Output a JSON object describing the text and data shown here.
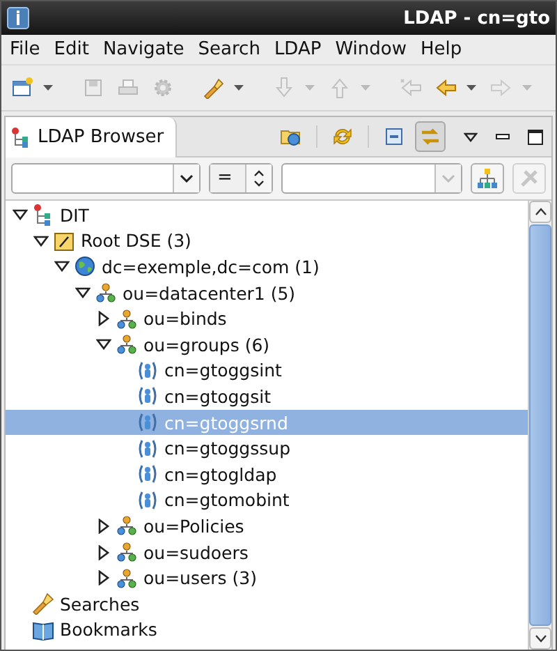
{
  "window": {
    "title": "LDAP - cn=gto"
  },
  "menu": [
    "File",
    "Edit",
    "Navigate",
    "Search",
    "LDAP",
    "Window",
    "Help"
  ],
  "toolbar": [
    {
      "kind": "new-window",
      "disabled": false,
      "dropdown": true
    },
    {
      "kind": "save",
      "disabled": true,
      "dropdown": false
    },
    {
      "kind": "print",
      "disabled": true,
      "dropdown": false
    },
    {
      "kind": "gear",
      "disabled": true,
      "dropdown": false
    },
    {
      "kind": "search",
      "disabled": false,
      "dropdown": true
    },
    {
      "kind": "import",
      "disabled": true,
      "dropdown": true
    },
    {
      "kind": "export",
      "disabled": true,
      "dropdown": true
    },
    {
      "kind": "last-edit",
      "disabled": true,
      "dropdown": false
    },
    {
      "kind": "back",
      "disabled": false,
      "dropdown": true
    },
    {
      "kind": "forward",
      "disabled": true,
      "dropdown": true
    }
  ],
  "view": {
    "tab": {
      "label": "LDAP Browser",
      "selected": true
    },
    "actions": [
      {
        "kind": "open-connection",
        "on": false
      },
      {
        "kind": "refresh",
        "on": false
      },
      {
        "kind": "collapse",
        "on": false
      },
      {
        "kind": "link",
        "on": true
      }
    ],
    "filter": {
      "attribute_disabled": false,
      "operator": "=",
      "value_disabled": true,
      "apply_disabled": false,
      "clear_disabled": true
    },
    "tree": [
      {
        "label": "DIT",
        "kind": "dit",
        "expanded": true,
        "selected": false,
        "children": [
          {
            "label": "Root DSE (3)",
            "kind": "root",
            "expanded": true,
            "selected": false,
            "children": [
              {
                "label": "dc=exemple,dc=com (1)",
                "kind": "domain",
                "expanded": true,
                "selected": false,
                "children": [
                  {
                    "label": "ou=datacenter1 (5)",
                    "kind": "ou",
                    "expanded": true,
                    "selected": false,
                    "children": [
                      {
                        "label": "ou=binds",
                        "kind": "ou",
                        "expanded": false,
                        "selected": false
                      },
                      {
                        "label": "ou=groups (6)",
                        "kind": "ou",
                        "expanded": true,
                        "selected": false,
                        "children": [
                          {
                            "label": "cn=gtoggsint",
                            "kind": "group",
                            "selected": false
                          },
                          {
                            "label": "cn=gtoggsit",
                            "kind": "group",
                            "selected": false
                          },
                          {
                            "label": "cn=gtoggsrnd",
                            "kind": "group",
                            "selected": true
                          },
                          {
                            "label": "cn=gtoggssup",
                            "kind": "group",
                            "selected": false
                          },
                          {
                            "label": "cn=gtogldap",
                            "kind": "group",
                            "selected": false
                          },
                          {
                            "label": "cn=gtomobint",
                            "kind": "group",
                            "selected": false
                          }
                        ]
                      },
                      {
                        "label": "ou=Policies",
                        "kind": "ou",
                        "expanded": false,
                        "selected": false
                      },
                      {
                        "label": "ou=sudoers",
                        "kind": "ou",
                        "expanded": false,
                        "selected": false
                      },
                      {
                        "label": "ou=users (3)",
                        "kind": "ou",
                        "expanded": false,
                        "selected": false
                      }
                    ]
                  }
                ]
              }
            ]
          }
        ]
      },
      {
        "label": "Searches",
        "kind": "searches",
        "selected": false
      },
      {
        "label": "Bookmarks",
        "kind": "bookmarks",
        "selected": false
      }
    ]
  }
}
